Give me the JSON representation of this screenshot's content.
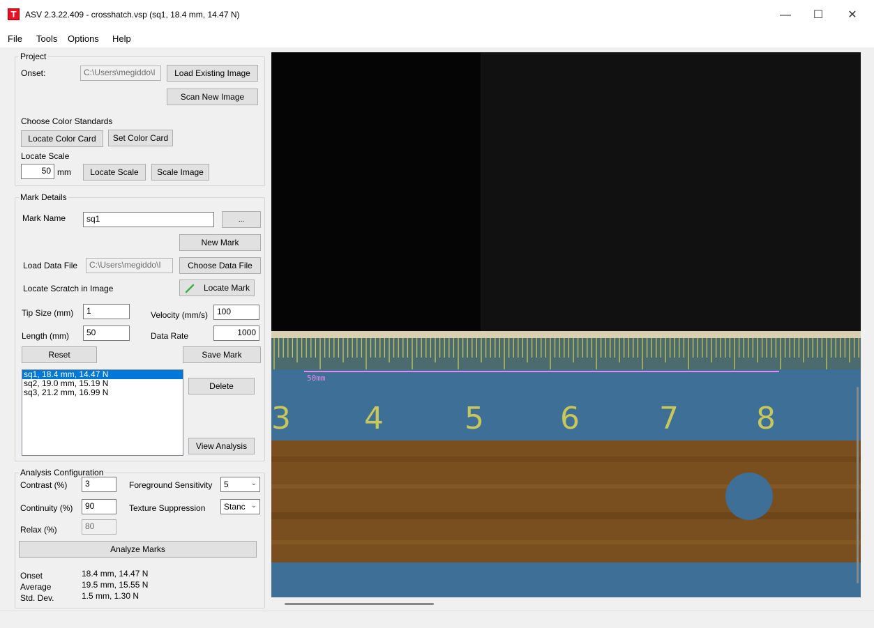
{
  "window": {
    "app_icon_letter": "T",
    "title": "ASV 2.3.22.409 - crosshatch.vsp (sq1, 18.4 mm, 14.47 N)",
    "minimize": "—",
    "maximize": "☐",
    "close": "✕"
  },
  "menu": {
    "file": "File",
    "tools": "Tools",
    "options": "Options",
    "help": "Help"
  },
  "project": {
    "group_label": "Project",
    "onset_label": "Onset:",
    "onset_path": "C:\\Users\\megiddo\\I",
    "load_existing_btn": "Load Existing Image",
    "scan_new_btn": "Scan New Image",
    "color_standards_label": "Choose Color Standards",
    "locate_color_card_btn": "Locate Color Card",
    "set_color_card_btn": "Set Color Card",
    "locate_scale_label": "Locate Scale",
    "scale_value": "50",
    "scale_unit": "mm",
    "locate_scale_btn": "Locate Scale",
    "scale_image_btn": "Scale Image"
  },
  "mark_details": {
    "group_label": "Mark Details",
    "mark_name_label": "Mark Name",
    "mark_name_value": "sq1",
    "ellipsis_btn": "...",
    "new_mark_btn": "New Mark",
    "load_data_file_label": "Load Data File",
    "data_file_path": "C:\\Users\\megiddo\\I",
    "choose_data_file_btn": "Choose Data File",
    "locate_scratch_label": "Locate Scratch in Image",
    "locate_mark_btn": "Locate Mark",
    "tip_size_label": "Tip Size (mm)",
    "tip_size_value": "1",
    "velocity_label": "Velocity (mm/s)",
    "velocity_value": "100",
    "length_label": "Length (mm)",
    "length_value": "50",
    "data_rate_label": "Data Rate",
    "data_rate_value": "1000",
    "reset_btn": "Reset",
    "save_mark_btn": "Save Mark",
    "marks": [
      "sq1, 18.4 mm, 14.47 N",
      "sq2, 19.0 mm, 15.19 N",
      "sq3, 21.2 mm, 16.99 N"
    ],
    "selected_index": 0,
    "delete_btn": "Delete",
    "view_analysis_btn": "View Analysis"
  },
  "analysis": {
    "group_label": "Analysis Configuration",
    "contrast_label": "Contrast (%)",
    "contrast_value": "3",
    "fg_sensitivity_label": "Foreground Sensitivity",
    "fg_sensitivity_value": "5",
    "continuity_label": "Continuity (%)",
    "continuity_value": "90",
    "texture_label": "Texture Suppression",
    "texture_value": "Stanc",
    "relax_label": "Relax (%)",
    "relax_value": "80",
    "analyze_btn": "Analyze Marks",
    "onset_label": "Onset",
    "onset_value": "18.4 mm, 14.47 N",
    "average_label": "Average",
    "average_value": "19.5 mm, 15.55 N",
    "stddev_label": "Std. Dev.",
    "stddev_value": "1.5 mm, 1.30 N"
  },
  "viewer": {
    "scale_label": "50mm",
    "ruler_numbers": [
      "3",
      "4",
      "5",
      "6",
      "7",
      "8"
    ],
    "colors": {
      "ruler_blue": "#3d6f97",
      "tick_yellow": "#c8c85a",
      "scale_line": "#e38ce8",
      "wood": "#7a4f1f"
    }
  }
}
